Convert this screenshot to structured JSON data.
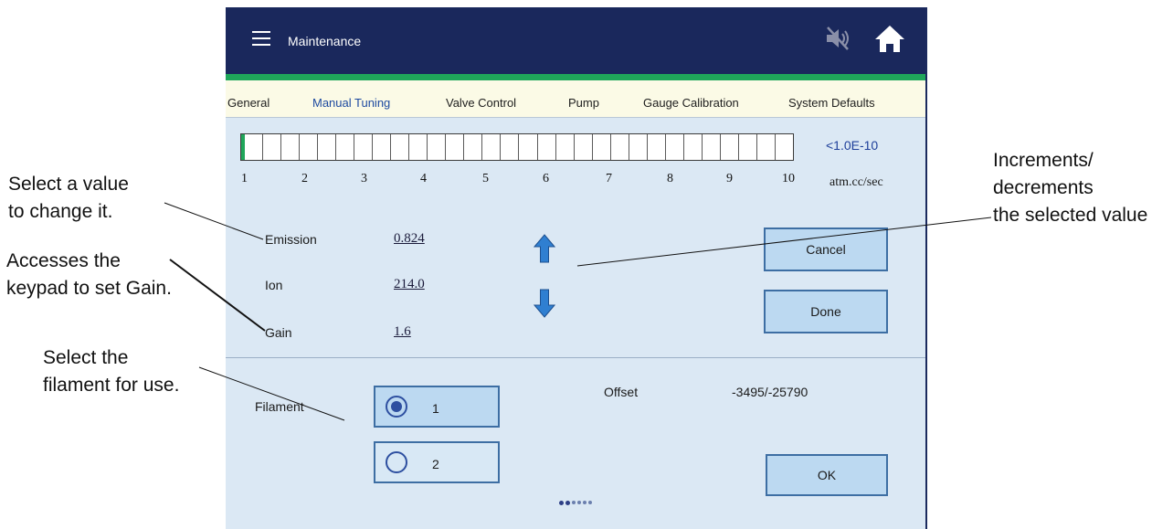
{
  "header": {
    "title": "Maintenance",
    "icons": {
      "menu": "menu-icon",
      "mute": "speaker-muted-icon",
      "home": "home-icon"
    }
  },
  "tabs": [
    {
      "label": "General",
      "active": false
    },
    {
      "label": "Manual Tuning",
      "active": true
    },
    {
      "label": "Valve Control",
      "active": false
    },
    {
      "label": "Pump",
      "active": false
    },
    {
      "label": "Gauge Calibration",
      "active": false
    },
    {
      "label": "System Defaults",
      "active": false
    }
  ],
  "leak_meter": {
    "scale": [
      "1",
      "2",
      "3",
      "4",
      "5",
      "6",
      "7",
      "8",
      "9",
      "10"
    ],
    "value": "<1.0E-10",
    "unit": "atm.cc/sec"
  },
  "params": {
    "emission": {
      "label": "Emission",
      "value": "0.824"
    },
    "ion": {
      "label": "Ion",
      "value": "214.0"
    },
    "gain": {
      "label": "Gain",
      "value": "1.6"
    }
  },
  "buttons": {
    "cancel": "Cancel",
    "done": "Done",
    "ok": "OK"
  },
  "filament": {
    "label": "Filament",
    "options": [
      {
        "label": "1",
        "selected": true
      },
      {
        "label": "2",
        "selected": false
      }
    ]
  },
  "offset": {
    "label": "Offset",
    "value": "-3495/-25790"
  },
  "pager": {
    "total": 6,
    "current": 2
  },
  "callouts": {
    "select_value": "Select a value\nto change it.",
    "keypad": "Accesses the\nkeypad to set Gain.",
    "filament": "Select the\nfilament for use.",
    "increments": "Increments/\ndecrements\nthe selected value"
  },
  "colors": {
    "header_bg": "#1a285c",
    "accent_green": "#1fa65a",
    "panel_bg": "#dbe8f4",
    "tab_bar_bg": "#fbfae6",
    "button_bg": "#bcd9f1",
    "arrow_blue": "#2f7fd1"
  }
}
